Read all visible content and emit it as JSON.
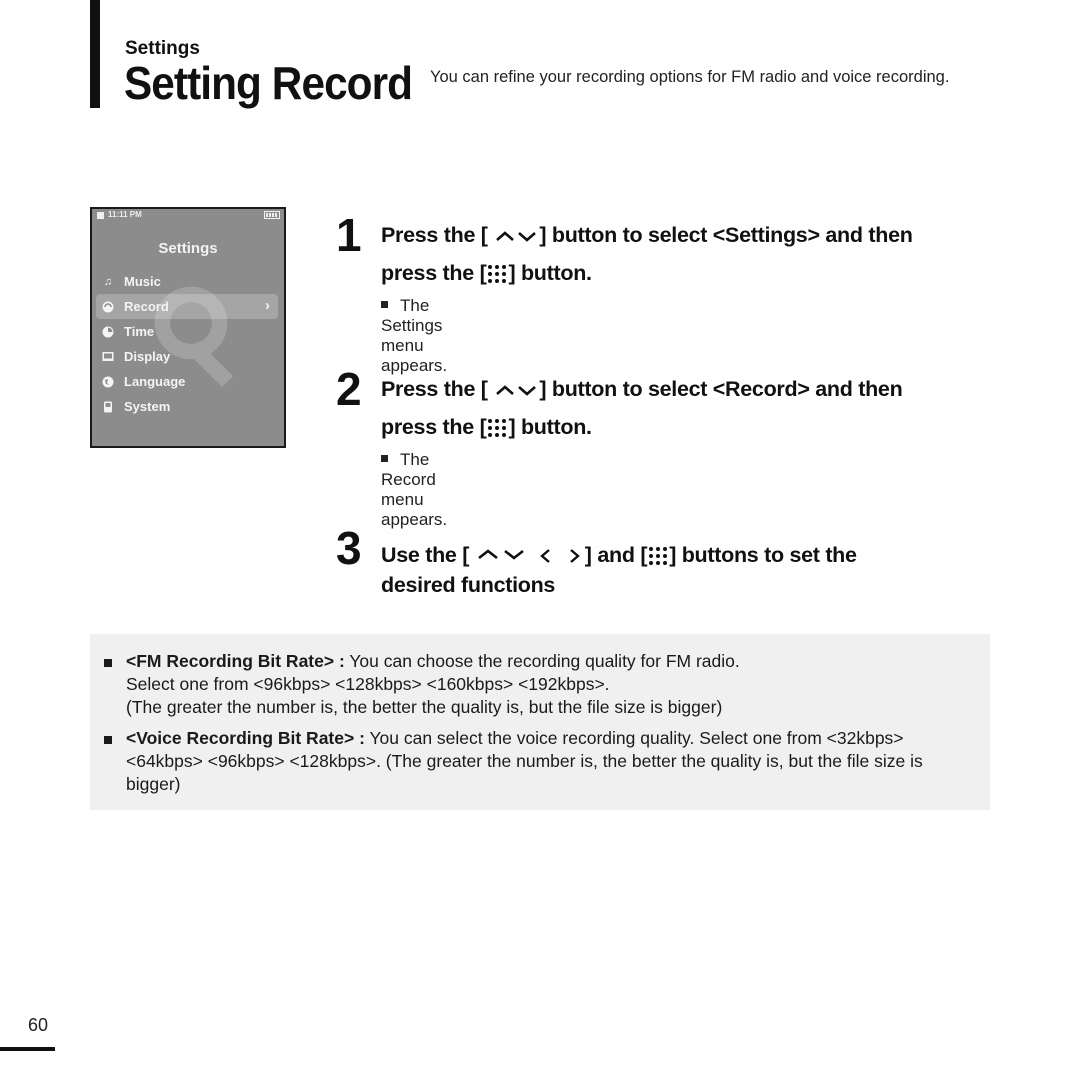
{
  "header": {
    "section": "Settings",
    "title": "Setting Record",
    "intro": "You can refine your recording options for FM radio and voice recording."
  },
  "device": {
    "status_time": "11:11 PM",
    "screen_title": "Settings",
    "menu": [
      {
        "label": "Music",
        "icon": "music-note-icon",
        "selected": false
      },
      {
        "label": "Record",
        "icon": "record-icon",
        "selected": true
      },
      {
        "label": "Time",
        "icon": "clock-icon",
        "selected": false
      },
      {
        "label": "Display",
        "icon": "display-icon",
        "selected": false
      },
      {
        "label": "Language",
        "icon": "globe-icon",
        "selected": false
      },
      {
        "label": "System",
        "icon": "device-icon",
        "selected": false
      }
    ]
  },
  "steps": [
    {
      "number": "1",
      "t1": "Press the [",
      "t2": "] button to select <Settings> and then",
      "t3": "press the [",
      "t4": "] button.",
      "note": "The Settings menu appears."
    },
    {
      "number": "2",
      "t1": "Press the [",
      "t2": "] button to select <Record> and then",
      "t3": "press the [",
      "t4": "] button.",
      "note": "The Record menu appears."
    },
    {
      "number": "3",
      "t1": "Use the [",
      "t2": "] and [",
      "t3": "] buttons to set the",
      "t4": "desired functions"
    }
  ],
  "info": [
    {
      "term": "<FM Recording Bit Rate> :",
      "line1": " You can choose the recording quality for FM radio.",
      "line2": "Select one from <96kbps> <128kbps> <160kbps> <192kbps>.",
      "line3": "(The greater the number is, the better the quality is, but the file size is bigger)"
    },
    {
      "term": "<Voice Recording Bit Rate> :",
      "text": " You can select the voice recording quality. Select one from <32kbps> <64kbps> <96kbps> <128kbps>. (The greater the number is, the better the quality is, but the file size is bigger)"
    }
  ],
  "footer": {
    "page_number": "60"
  }
}
